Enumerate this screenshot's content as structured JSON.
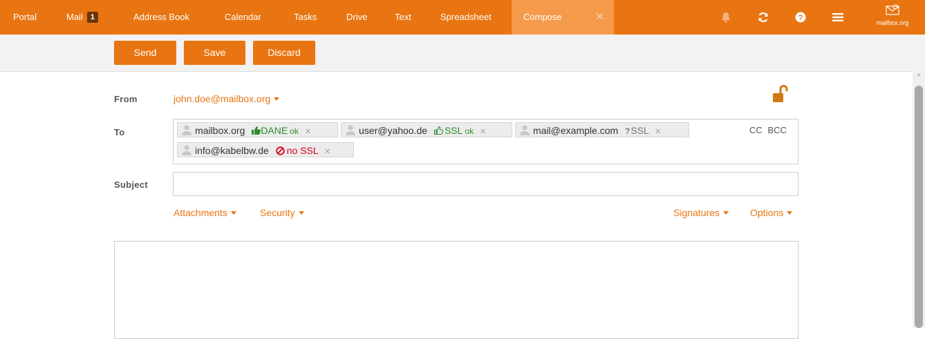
{
  "nav": {
    "portal": "Portal",
    "mail": "Mail",
    "mail_count": "1",
    "address_book": "Address Book",
    "calendar": "Calendar",
    "tasks": "Tasks",
    "drive": "Drive",
    "text": "Text",
    "spreadsheet": "Spreadsheet",
    "compose": "Compose",
    "close_icon": "close-icon",
    "icons": [
      "bell-icon",
      "refresh-icon",
      "help-icon",
      "menu-icon"
    ],
    "logo_text": "mailbox.org"
  },
  "toolbar": {
    "send": "Send",
    "save": "Save",
    "discard": "Discard"
  },
  "form": {
    "from_label": "From",
    "from_value": "john.doe@mailbox.org",
    "to_label": "To",
    "subject_label": "Subject",
    "subject_value": "",
    "cc": "CC",
    "bcc": "BCC",
    "recipients": [
      {
        "address": "mailbox.org",
        "security": "DANE",
        "status": "ok",
        "icon": "thumbs-up-filled-icon",
        "color": "#2e8b2e"
      },
      {
        "address": "user@yahoo.de",
        "security": "SSL",
        "status": "ok",
        "icon": "thumbs-up-outline-icon",
        "color": "#2e8b2e"
      },
      {
        "address": "mail@example.com",
        "security": "SSL",
        "status": "",
        "icon": "question-icon",
        "color": "#777777"
      },
      {
        "address": "info@kabelbw.de",
        "security": "no SSL",
        "status": "",
        "icon": "ban-icon",
        "color": "#d8001a"
      }
    ],
    "attachments": "Attachments",
    "security": "Security",
    "signatures": "Signatures",
    "options": "Options"
  },
  "colors": {
    "accent": "#e87511",
    "active_tab": "#f59a4a",
    "ok": "#2e8b2e",
    "bad": "#d8001a"
  }
}
